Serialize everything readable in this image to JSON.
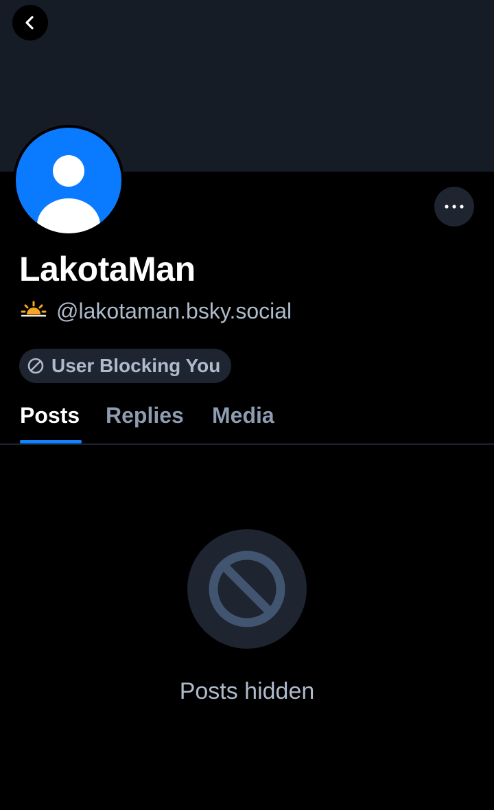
{
  "profile": {
    "display_name": "LakotaMan",
    "handle": "@lakotaman.bsky.social",
    "handle_emoji": "sunrise-icon",
    "block_status": "User Blocking You"
  },
  "tabs": [
    {
      "label": "Posts",
      "active": true
    },
    {
      "label": "Replies",
      "active": false
    },
    {
      "label": "Media",
      "active": false
    }
  ],
  "content": {
    "empty_state_label": "Posts hidden",
    "empty_state_icon": "prohibited-icon"
  },
  "colors": {
    "banner": "#161c26",
    "avatar": "#0a7aff",
    "accent": "#1083fe",
    "muted_text": "#aebbcb",
    "pill_bg": "#1e2530"
  }
}
